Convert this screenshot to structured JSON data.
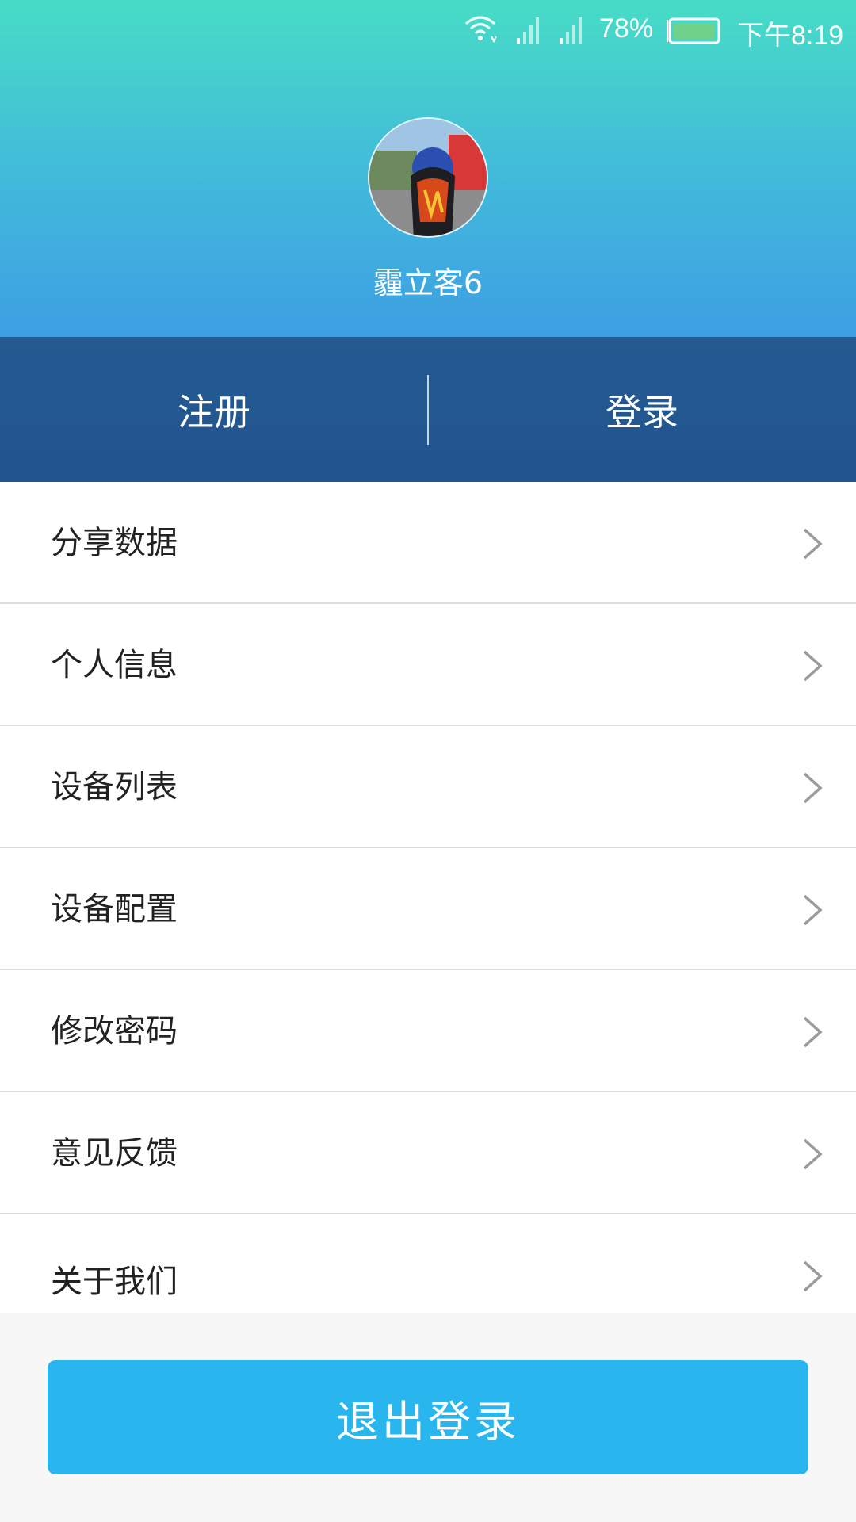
{
  "status_bar": {
    "battery_percent": "78%",
    "time": "下午8:19",
    "icons": [
      "wifi-icon",
      "signal-icon",
      "signal-icon",
      "battery-icon"
    ]
  },
  "profile": {
    "username": "霾立客6",
    "avatar": "avatar-photo"
  },
  "auth": {
    "register_label": "注册",
    "login_label": "登录"
  },
  "menu": {
    "items": [
      {
        "label": "分享数据"
      },
      {
        "label": "个人信息"
      },
      {
        "label": "设备列表"
      },
      {
        "label": "设备配置"
      },
      {
        "label": "修改密码"
      },
      {
        "label": "意见反馈"
      },
      {
        "label": "关于我们"
      }
    ]
  },
  "logout": {
    "label": "退出登录"
  },
  "colors": {
    "header_top": "#47dcc6",
    "header_bottom": "#3a86e0",
    "auth_bar": "#1c4678",
    "logout_button": "#29b6ee",
    "chevron": "#9a9a9a"
  }
}
